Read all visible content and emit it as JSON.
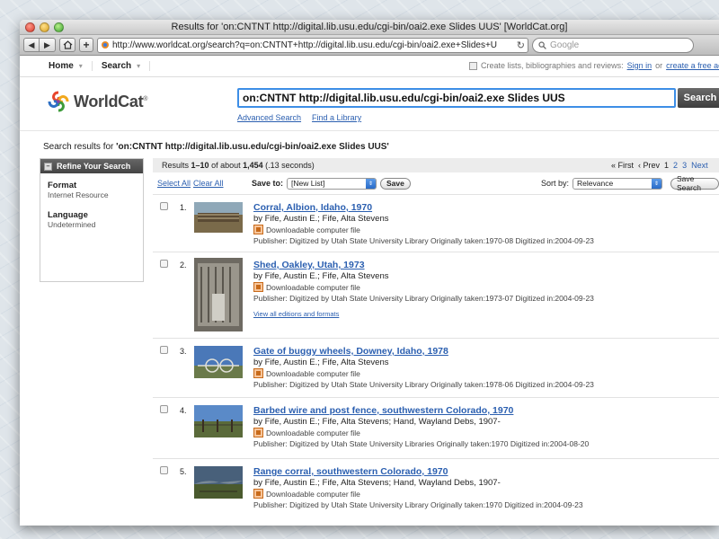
{
  "window": {
    "title": "Results for 'on:CNTNT http://digital.lib.usu.edu/cgi-bin/oai2.exe Slides UUS' [WorldCat.org]"
  },
  "browser": {
    "url": "http://www.worldcat.org/search?q=on:CNTNT+http://digital.lib.usu.edu/cgi-bin/oai2.exe+Slides+U",
    "search_placeholder": "Google"
  },
  "topnav": {
    "home": "Home",
    "search": "Search",
    "promo_text": "Create lists, bibliographies and reviews:",
    "sign_in": "Sign in",
    "or": "or",
    "create_account": "create a free accou"
  },
  "header": {
    "logo_text": "WorldCat",
    "logo_mark": "®",
    "query": "on:CNTNT http://digital.lib.usu.edu/cgi-bin/oai2.exe Slides UUS",
    "search_button": "Search",
    "advanced_search": "Advanced Search",
    "find_library": "Find a Library"
  },
  "results_heading": {
    "prefix": "Search results for",
    "query": "'on:CNTNT http://digital.lib.usu.edu/cgi-bin/oai2.exe Slides UUS'"
  },
  "sidebar": {
    "title": "Refine Your Search",
    "facets": [
      {
        "title": "Format",
        "value": "Internet Resource"
      },
      {
        "title": "Language",
        "value": "Undetermined"
      }
    ]
  },
  "results_bar": {
    "summary_prefix": "Results",
    "range": "1–10",
    "of_about": "of about",
    "total": "1,454",
    "time": "(.13 seconds)",
    "first": "« First",
    "prev": "‹ Prev",
    "pages": [
      "1",
      "2",
      "3"
    ],
    "next": "Next"
  },
  "actions": {
    "select_all": "Select All",
    "clear_all": "Clear All",
    "save_to": "Save to:",
    "list_value": "[New List]",
    "save": "Save",
    "sort_by": "Sort by:",
    "sort_value": "Relevance",
    "save_search": "Save Search"
  },
  "results": [
    {
      "num": "1.",
      "title": "Corral, Albion, Idaho, 1970",
      "author": "by Fife, Austin E.; Fife, Alta Stevens",
      "format": "Downloadable computer file",
      "publisher": "Publisher: Digitized by Utah State University Library Originally taken:1970-08 Digitized in:2004-09-23",
      "thumb": "corral"
    },
    {
      "num": "2.",
      "title": "Shed, Oakley, Utah, 1973",
      "author": "by Fife, Austin E.; Fife, Alta Stevens",
      "format": "Downloadable computer file",
      "publisher": "Publisher: Digitized by Utah State University Library Originally taken:1973-07 Digitized in:2004-09-23",
      "editions": "View all editions and formats",
      "thumb": "shed"
    },
    {
      "num": "3.",
      "title": "Gate of buggy wheels, Downey, Idaho, 1978",
      "author": "by Fife, Austin E.; Fife, Alta Stevens",
      "format": "Downloadable computer file",
      "publisher": "Publisher: Digitized by Utah State University Library Originally taken:1978-06 Digitized in:2004-09-23",
      "thumb": "gate"
    },
    {
      "num": "4.",
      "title": "Barbed wire and post fence, southwestern Colorado, 1970",
      "author": "by Fife, Austin E.; Fife, Alta Stevens; Hand, Wayland Debs, 1907-",
      "format": "Downloadable computer file",
      "publisher": "Publisher: Digitized by Utah State University Libraries Originally taken:1970 Digitized in:2004-08-20",
      "thumb": "fence"
    },
    {
      "num": "5.",
      "title": "Range corral, southwestern Colorado, 1970",
      "author": "by Fife, Austin E.; Fife, Alta Stevens; Hand, Wayland Debs, 1907-",
      "format": "Downloadable computer file",
      "publisher": "Publisher: Digitized by Utah State University Library Originally taken:1970 Digitized in:2004-09-23",
      "thumb": "range"
    }
  ],
  "colors": {
    "link": "#2b5fb0",
    "query_border": "#3d8ee6",
    "sidebar_header": "#555555"
  }
}
